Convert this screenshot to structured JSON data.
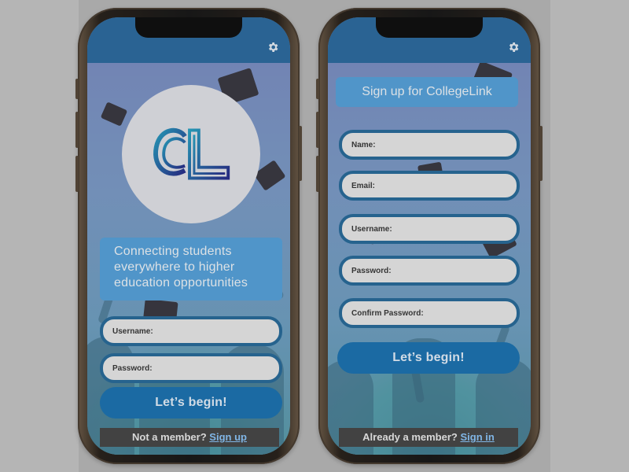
{
  "left_phone": {
    "tagline": "Connecting students everywhere to higher education opportunities",
    "fields": [
      {
        "label": "Username:",
        "value": "",
        "placeholder": ""
      },
      {
        "label": "Password:",
        "value": "",
        "placeholder": ""
      }
    ],
    "primary_button": "Let’s begin!",
    "footer": {
      "question": "Not a member?",
      "link": "Sign up"
    },
    "logo_text": "CL"
  },
  "right_phone": {
    "title": "Sign up for CollegeLink",
    "fields": [
      {
        "label": "Name:",
        "value": "",
        "placeholder": ""
      },
      {
        "label": "Email:",
        "value": "",
        "placeholder": ""
      },
      {
        "label": "Username:",
        "value": "",
        "placeholder": ""
      },
      {
        "label": "Password:",
        "value": "",
        "placeholder": ""
      },
      {
        "label": "Confirm Password:",
        "value": "",
        "placeholder": ""
      }
    ],
    "primary_button": "Let’s begin!",
    "footer": {
      "question": "Already a member?",
      "link": "Sign in"
    }
  },
  "icons": {
    "settings": "gear-icon"
  },
  "colors": {
    "header_blue": "#2f6fa4",
    "card_blue": "#5aa6e0",
    "button_blue": "#1f77b6",
    "field_border": "#2b6f9f",
    "link_blue": "#8fcaff",
    "footer_bg": "#4a4a4a"
  }
}
